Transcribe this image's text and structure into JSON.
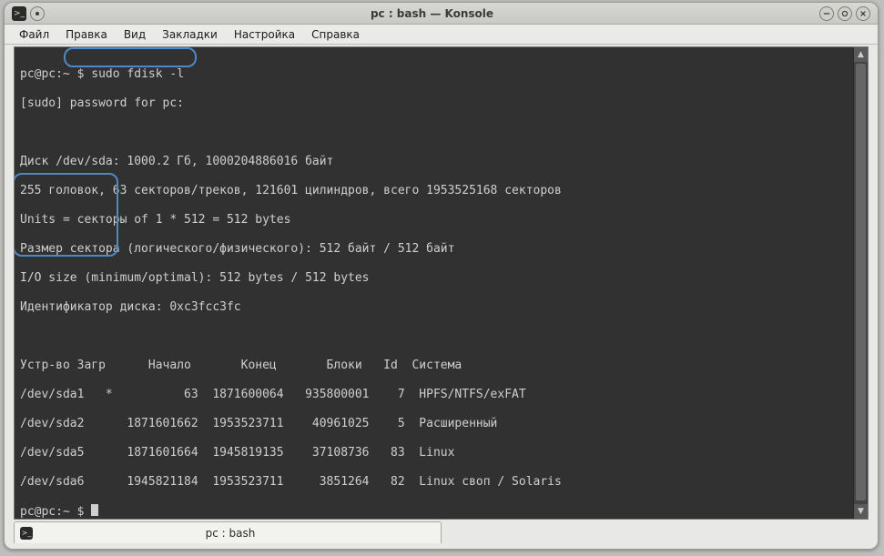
{
  "window": {
    "title": "pc : bash — Konsole"
  },
  "menubar": {
    "items": [
      "Файл",
      "Правка",
      "Вид",
      "Закладки",
      "Настройка",
      "Справка"
    ]
  },
  "terminal": {
    "prompt1_user": "pc@pc:~",
    "prompt1_sym": "$",
    "command": "sudo fdisk -l",
    "sudo_line": "[sudo] password for pc:",
    "disk_line": "Диск /dev/sda: 1000.2 Гб, 1000204886016 байт",
    "heads_line": "255 головок, 63 секторов/треков, 121601 цилиндров, всего 1953525168 секторов",
    "units_line": "Units = секторы of 1 * 512 = 512 bytes",
    "sector_line": "Размер сектора (логического/физического): 512 байт / 512 байт",
    "iosize_line": "I/O size (minimum/optimal): 512 bytes / 512 bytes",
    "diskid_line": "Идентификатор диска: 0xc3fcc3fc",
    "table_header": "Устр-во Загр      Начало       Конец       Блоки   Id  Система",
    "rows": {
      "r0": "/dev/sda1   *          63  1871600064   935800001    7  HPFS/NTFS/exFAT",
      "r1": "/dev/sda2      1871601662  1953523711    40961025    5  Расширенный",
      "r2": "/dev/sda5      1871601664  1945819135    37108736   83  Linux",
      "r3": "/dev/sda6      1945821184  1953523711     3851264   82  Linux своп / Solaris"
    },
    "prompt2_user": "pc@pc:~",
    "prompt2_sym": "$"
  },
  "tab": {
    "label": "pc : bash"
  }
}
